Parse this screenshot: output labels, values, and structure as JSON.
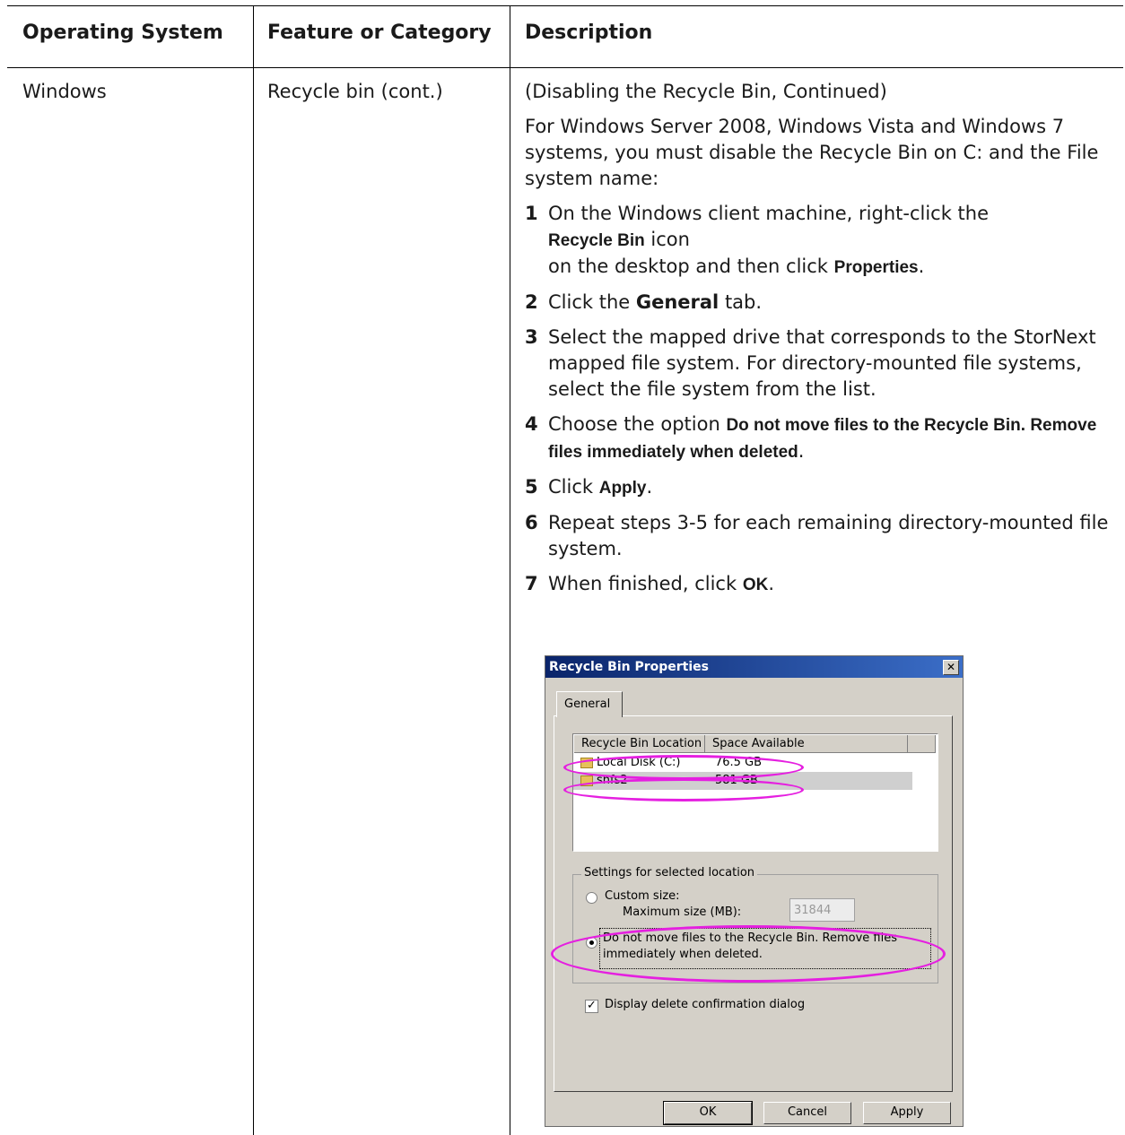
{
  "table": {
    "headers": [
      "Operating System",
      "Feature or Category",
      "Description"
    ],
    "os": "Windows",
    "feature": "Recycle bin (cont.)"
  },
  "description": {
    "intro_heading": "(Disabling the Recycle Bin, Continued)",
    "intro": "For Windows Server 2008, Windows Vista and Windows 7 systems, you must disable the Recycle Bin on C: and the File system name:",
    "steps": [
      {
        "num": "1",
        "parts": [
          "On the Windows client machine, right-click the ",
          "Recycle Bin",
          " icon",
          "on the desktop and then click ",
          "Properties",
          "."
        ]
      },
      {
        "num": "2",
        "parts": [
          "Click the ",
          "General",
          " tab."
        ]
      },
      {
        "num": "3",
        "parts": [
          "Select the mapped drive that corresponds to the StorNext mapped file system. For directory-mounted file systems, select the file system from the list."
        ]
      },
      {
        "num": "4",
        "parts": [
          "Choose the option ",
          "Do not move files to the Recycle Bin. Remove files immediately when deleted",
          "."
        ]
      },
      {
        "num": "5",
        "parts": [
          "Click ",
          "Apply",
          "."
        ]
      },
      {
        "num": "6",
        "parts": [
          "Repeat steps 3-5 for each remaining directory-mounted file system."
        ]
      },
      {
        "num": "7",
        "parts": [
          "When finished, click ",
          "OK",
          "."
        ]
      }
    ]
  },
  "dialog": {
    "title": "Recycle Bin Properties",
    "close_glyph": "✕",
    "tab": "General",
    "columns": [
      "Recycle Bin Location",
      "Space Available"
    ],
    "rows": [
      {
        "location": "Local Disk (C:)",
        "space": "76.5 GB"
      },
      {
        "location": "snfs2",
        "space": "581 GB"
      }
    ],
    "group_label": "Settings for selected location",
    "custom_size": "Custom size:",
    "max_size_label": "Maximum size (MB):",
    "max_size_value": "31844",
    "do_not_move_1": "Do not move files to the Recycle Bin. Remove files",
    "do_not_move_2": "immediately when deleted.",
    "display_confirm": "Display delete confirmation dialog",
    "check_glyph": "✓",
    "ok": "OK",
    "cancel": "Cancel",
    "apply": "Apply"
  },
  "colors": {
    "highlight_oval": "#e51fe0",
    "title_bar": "#0a246a"
  }
}
